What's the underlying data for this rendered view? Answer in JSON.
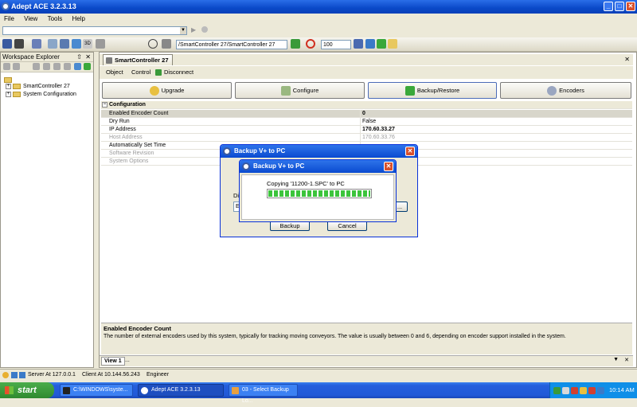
{
  "app": {
    "title": "Adept ACE 3.2.3.13"
  },
  "menu": [
    "File",
    "View",
    "Tools",
    "Help"
  ],
  "toolbar": {
    "path": "/SmartController 27/SmartController 27",
    "zoom": "100"
  },
  "workspace": {
    "title": "Workspace Explorer",
    "pin": "⇧",
    "close": "✕",
    "items": [
      {
        "label": "SmartController 27"
      },
      {
        "label": "System Configuration"
      }
    ]
  },
  "document": {
    "tab": "SmartController 27",
    "close": "✕",
    "submenu": {
      "object": "Object",
      "control": "Control",
      "disconnect": "Disconnect"
    },
    "buttons": [
      "Upgrade",
      "Configure",
      "Backup/Restore",
      "Encoders"
    ],
    "grid": {
      "category": "Configuration",
      "rows": [
        {
          "key": "Enabled Encoder Count",
          "value": "0",
          "style": "sel bold"
        },
        {
          "key": "Dry Run",
          "value": "False",
          "style": ""
        },
        {
          "key": "IP Address",
          "value": "170.60.33.27",
          "style": "bold"
        },
        {
          "key": "Host Address",
          "value": "170.60.33.76",
          "style": "gray"
        },
        {
          "key": "Automatically Set Time",
          "value": "",
          "style": ""
        },
        {
          "key": "Software Revision",
          "value": "",
          "style": "gray"
        },
        {
          "key": "System Options",
          "value": "",
          "style": "gray"
        }
      ]
    },
    "description": {
      "title": "Enabled Encoder Count",
      "text": "The number of external encoders used by this system, typically for tracking moving conveyors. The value is usually between 0 and 6, depending on encoder support installed in the system."
    },
    "view_tab": "View 1",
    "view_more": "..."
  },
  "dialog_outer": {
    "title": "Backup V+ to PC",
    "partial_label": "Di",
    "partial_field": "E:",
    "browse": "...",
    "backup": "Backup",
    "cancel": "Cancel"
  },
  "dialog_inner": {
    "title": "Backup V+ to PC",
    "message": "Copying '11200-1.SPC' to PC",
    "progress": 1.0
  },
  "status": {
    "server": "Server At 127.0.0.1",
    "client": "Client At 10.144.56.243",
    "role": "Engineer"
  },
  "taskbar": {
    "start": "start",
    "tasks": [
      "C:\\WINDOWS\\syste...",
      "Adept ACE 3.2.3.13",
      "03 - Select Backup Lo..."
    ],
    "time": "10:14 AM"
  },
  "colors": {
    "titlebar": "#0a49c8",
    "progress": "#3cc43c",
    "start": "#2f8a2f"
  }
}
